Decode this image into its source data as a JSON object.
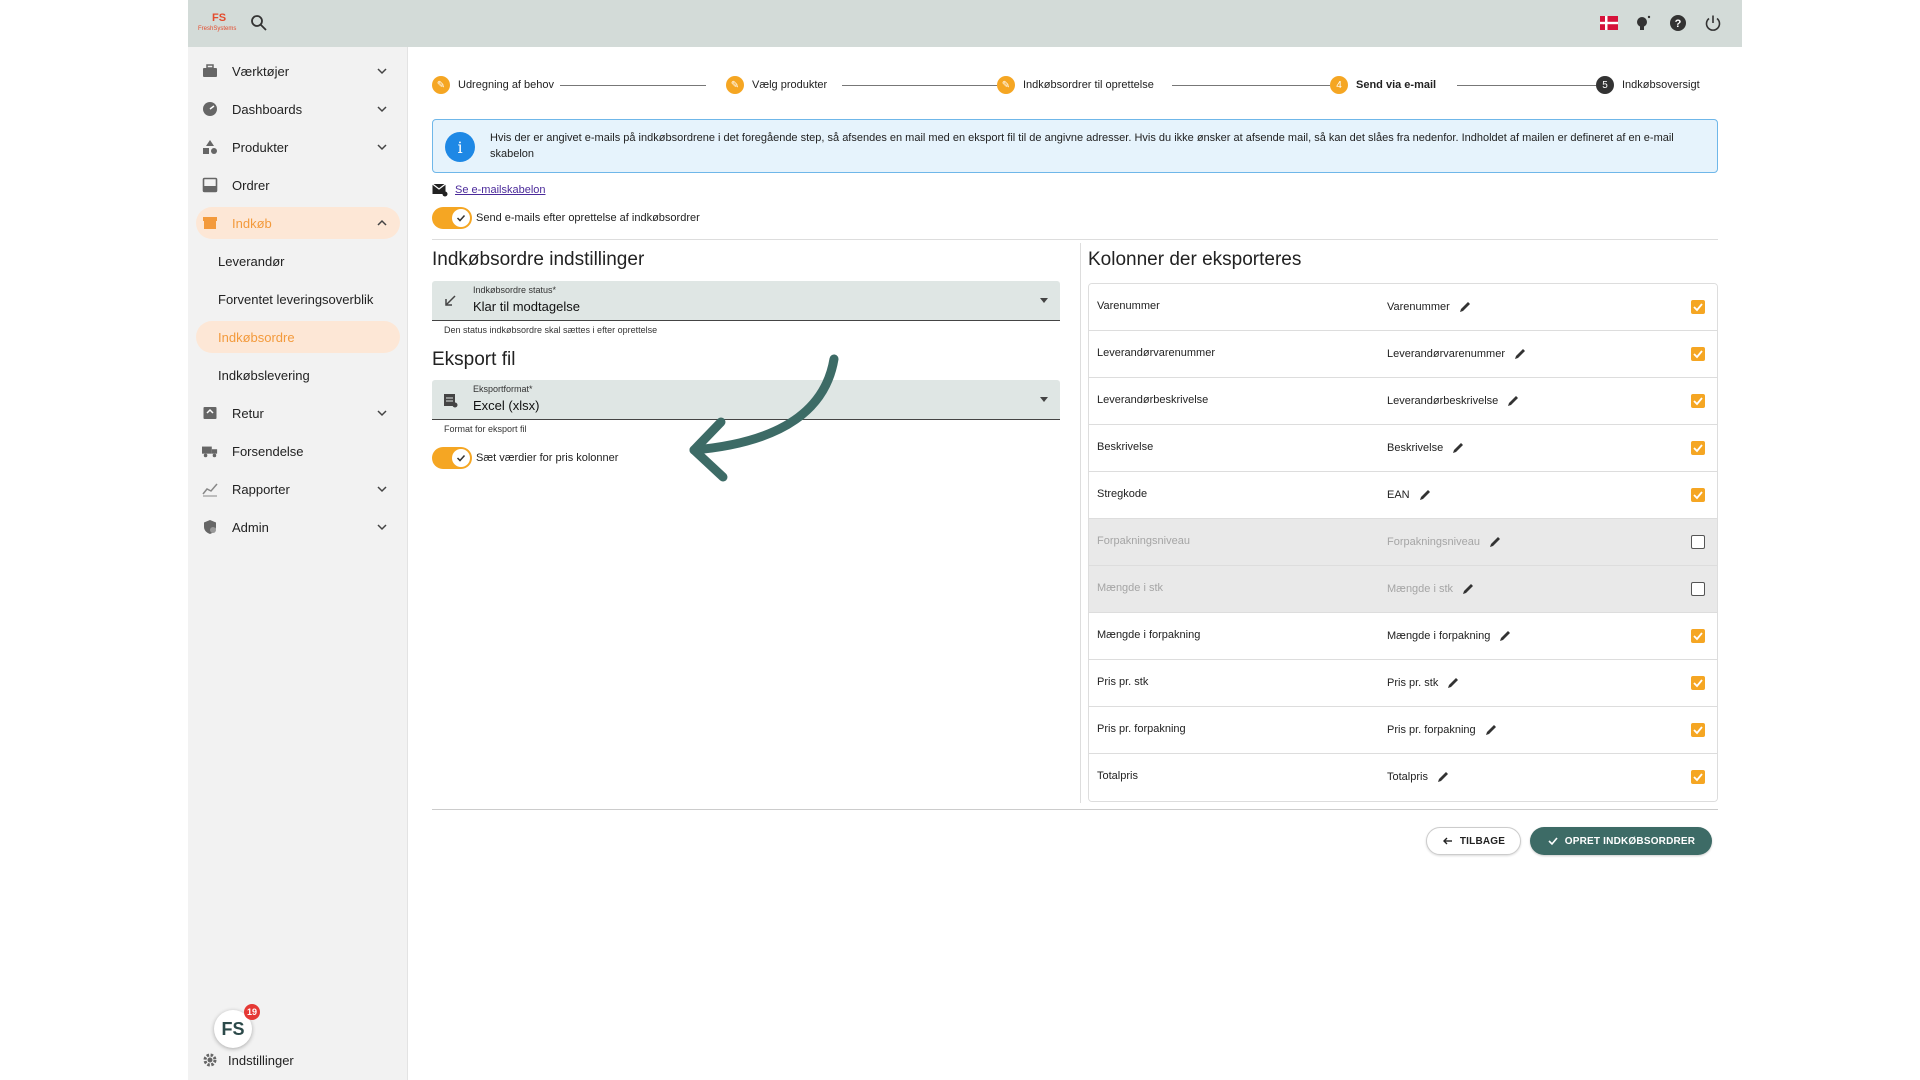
{
  "topbar": {
    "logo_text": "FS",
    "logo_sub": "FreshSystems"
  },
  "sidebar": {
    "items": [
      {
        "label": "Værktøjer",
        "icon": "toolbox-icon"
      },
      {
        "label": "Dashboards",
        "icon": "dashboard-icon"
      },
      {
        "label": "Produkter",
        "icon": "shapes-icon"
      },
      {
        "label": "Ordrer",
        "icon": "inbox-icon"
      },
      {
        "label": "Indkøb",
        "icon": "store-icon"
      },
      {
        "label": "Retur",
        "icon": "return-icon"
      },
      {
        "label": "Forsendelse",
        "icon": "truck-icon"
      },
      {
        "label": "Rapporter",
        "icon": "chart-icon"
      },
      {
        "label": "Admin",
        "icon": "admin-icon"
      }
    ],
    "sub_items": [
      "Leverandør",
      "Forventet leveringsoverblik",
      "Indkøbsordre",
      "Indkøbslevering"
    ],
    "settings_label": "Indstillinger",
    "badge_count": "19",
    "badge_text": "FS"
  },
  "stepper": {
    "steps": [
      {
        "label": "Udregning af behov",
        "marker": "✎"
      },
      {
        "label": "Vælg produkter",
        "marker": "✎"
      },
      {
        "label": "Indkøbsordrer til oprettelse",
        "marker": "✎"
      },
      {
        "label": "Send via e-mail",
        "marker": "4"
      },
      {
        "label": "Indkøbsoversigt",
        "marker": "5"
      }
    ]
  },
  "info": {
    "text": "Hvis der er angivet e-mails på indkøbsordrene i det foregående step, så afsendes en mail med en eksport fil til de angivne adresser. Hvis du ikke ønsker at afsende mail, så kan det slåes fra nedenfor. Indholdet af mailen er defineret af en e-mail skabelon"
  },
  "email": {
    "link": "Se e-mailskabelon",
    "toggle_label": "Send e-mails efter oprettelse af indkøbsordrer"
  },
  "settings": {
    "title": "Indkøbsordre indstillinger",
    "status_label": "Indkøbsordre status*",
    "status_value": "Klar til modtagelse",
    "status_helper": "Den status indkøbsordre skal sættes i efter oprettelse"
  },
  "export": {
    "title": "Eksport fil",
    "format_label": "Eksportformat*",
    "format_value": "Excel (xlsx)",
    "format_helper": "Format for eksport fil",
    "price_toggle_label": "Sæt værdier for pris kolonner"
  },
  "columns": {
    "title": "Kolonner der eksporteres",
    "rows": [
      {
        "name": "Varenummer",
        "export_name": "Varenummer",
        "checked": true
      },
      {
        "name": "Leverandørvarenummer",
        "export_name": "Leverandørvarenummer",
        "checked": true
      },
      {
        "name": "Leverandørbeskrivelse",
        "export_name": "Leverandørbeskrivelse",
        "checked": true
      },
      {
        "name": "Beskrivelse",
        "export_name": "Beskrivelse",
        "checked": true
      },
      {
        "name": "Stregkode",
        "export_name": "EAN",
        "checked": true
      },
      {
        "name": "Forpakningsniveau",
        "export_name": "Forpakningsniveau",
        "checked": false
      },
      {
        "name": "Mængde i stk",
        "export_name": "Mængde i stk",
        "checked": false
      },
      {
        "name": "Mængde i forpakning",
        "export_name": "Mængde i forpakning",
        "checked": true
      },
      {
        "name": "Pris pr. stk",
        "export_name": "Pris pr. stk",
        "checked": true
      },
      {
        "name": "Pris pr. forpakning",
        "export_name": "Pris pr. forpakning",
        "checked": true
      },
      {
        "name": "Totalpris",
        "export_name": "Totalpris",
        "checked": true
      }
    ]
  },
  "actions": {
    "back": "TILBAGE",
    "create": "OPRET INDKØBSORDRER"
  },
  "colors": {
    "accent": "#f5a623",
    "primary": "#3d6b66",
    "topbar": "#d3dbd8",
    "info_bg": "#e6f3fc",
    "annotation_arrow": "#3d6b66"
  }
}
